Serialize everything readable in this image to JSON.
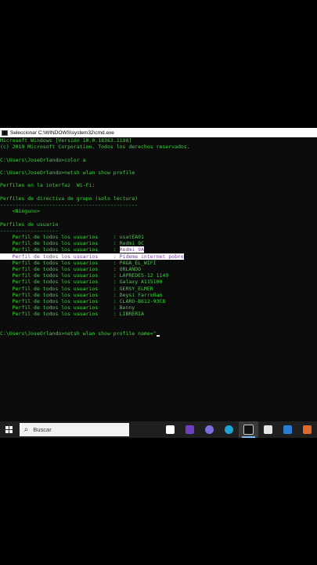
{
  "window": {
    "title": "Seleccionar C:\\WINDOWS\\system32\\cmd.exe"
  },
  "console": {
    "lines": [
      "Microsoft Windows [Versión 10.0.18363.1198]",
      "(c) 2019 Microsoft Corporation. Todos los derechos reservados.",
      "",
      "C:\\Users\\JoseOrlando>color a",
      "",
      "C:\\Users\\JoseOrlando>netsh wlan show profile",
      "",
      "Perfiles en la interfaz  Wi-Fi:",
      "",
      "Perfiles de directiva de grupo (solo lectura)",
      "---------------------------------------------",
      "    <Ninguno>",
      "",
      "Perfiles de usuario",
      "-------------------"
    ],
    "profile_label": "    Perfil de todos los usuarios     : ",
    "profiles": [
      "usatEA01",
      "Redmi 9C",
      "Redmi 9A",
      "Pideme internet pobre",
      "PAGA_EL_WIFI",
      "ORLANDO",
      "LAPREDES-12 1149",
      "Galaxy A115100",
      "GERSY_ELMER",
      "Deysi Farroñan",
      "CLARO-B612-93C8",
      "Benny",
      "LIBRERIA"
    ],
    "selected_indexes": [
      2,
      3
    ],
    "prompt_line": "C:\\Users\\JoseOrlando>netsh wlan show profile name=\""
  },
  "taskbar": {
    "search_placeholder": "Buscar",
    "icons": [
      {
        "name": "task-view-icon",
        "color": "#ffffff"
      },
      {
        "name": "visual-studio-icon",
        "color": "#6f3fc6"
      },
      {
        "name": "obs-icon",
        "color": "#7b6fe0"
      },
      {
        "name": "edge-icon",
        "color": "#1fa3d9"
      },
      {
        "name": "cmd-icon",
        "color": "#c8c8c8"
      },
      {
        "name": "store-icon",
        "color": "#e6e6e6"
      },
      {
        "name": "mail-icon",
        "color": "#2a7fd4"
      },
      {
        "name": "security-icon",
        "color": "#e06a2c"
      }
    ],
    "active_index": 4
  },
  "colors": {
    "console_bg": "#0c0c0c",
    "console_text": "#3fd13f",
    "selection_bg": "#ffffff",
    "selection_text": "#7a3fa0"
  }
}
